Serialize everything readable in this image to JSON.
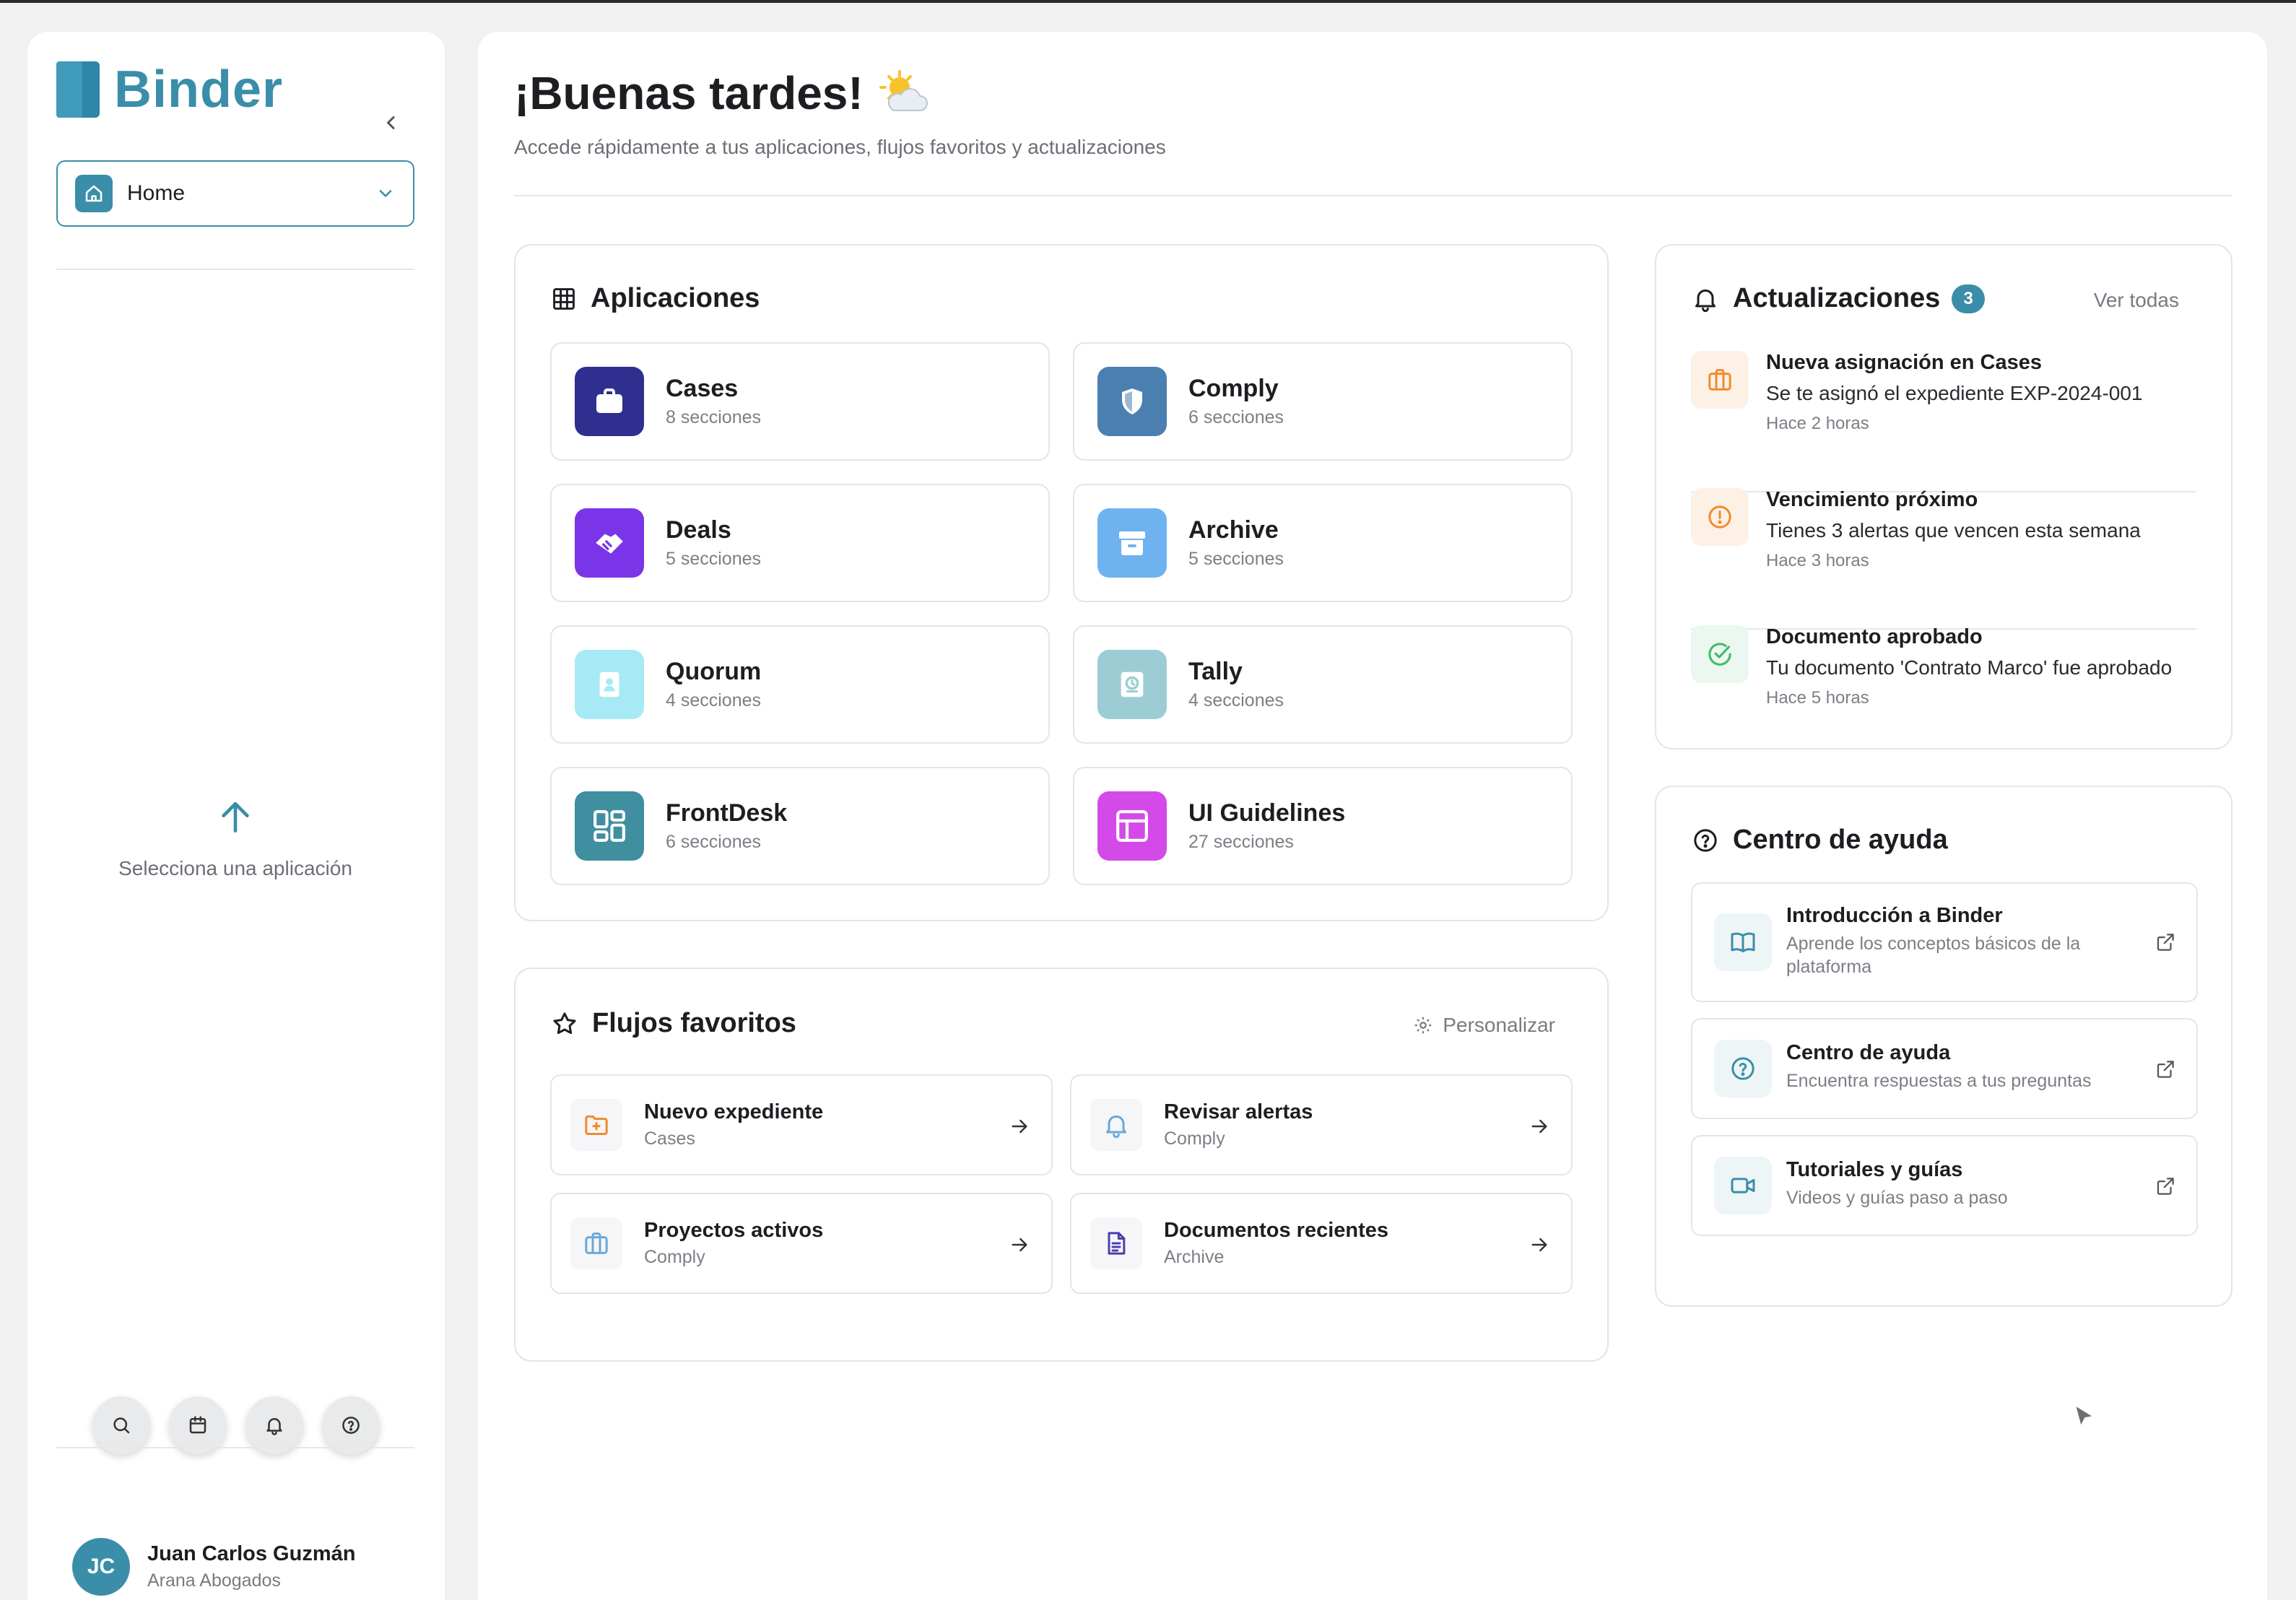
{
  "sidebar": {
    "logo_text": "Binder",
    "home_select": {
      "label": "Home"
    },
    "empty_state": "Selecciona una aplicación",
    "tools": [
      "search-icon",
      "calendar-icon",
      "bell-icon",
      "help-circle-icon"
    ],
    "user": {
      "initials": "JC",
      "name": "Juan Carlos Guzmán",
      "org": "Arana Abogados"
    }
  },
  "header": {
    "greeting": "¡Buenas tardes!",
    "subtitle": "Accede rápidamente a tus aplicaciones, flujos favoritos y actualizaciones"
  },
  "apps": {
    "title": "Aplicaciones",
    "items": [
      {
        "name": "Cases",
        "sections": "8 secciones",
        "color": "#2e2f8f",
        "icon": "briefcase-icon"
      },
      {
        "name": "Comply",
        "sections": "6 secciones",
        "color": "#4a7fb0",
        "icon": "shield-icon"
      },
      {
        "name": "Deals",
        "sections": "5 secciones",
        "color": "#7a35e8",
        "icon": "handshake-icon"
      },
      {
        "name": "Archive",
        "sections": "5 secciones",
        "color": "#6fb2f0",
        "icon": "archive-box-icon"
      },
      {
        "name": "Quorum",
        "sections": "4 secciones",
        "color": "#a7e9f5",
        "icon": "contact-book-icon"
      },
      {
        "name": "Tally",
        "sections": "4 secciones",
        "color": "#9ccdd5",
        "icon": "clock-ledger-icon"
      },
      {
        "name": "FrontDesk",
        "sections": "6 secciones",
        "color": "#3f8fa0",
        "icon": "grid-dashboard-icon"
      },
      {
        "name": "UI Guidelines",
        "sections": "27 secciones",
        "color": "#d44ae8",
        "icon": "layout-icon"
      }
    ]
  },
  "flows": {
    "title": "Flujos favoritos",
    "customize_label": "Personalizar",
    "items": [
      {
        "name": "Nuevo expediente",
        "app": "Cases",
        "icon": "folder-plus-icon",
        "color": "#f08a2e"
      },
      {
        "name": "Revisar alertas",
        "app": "Comply",
        "icon": "bell-icon",
        "color": "#6aa8d8"
      },
      {
        "name": "Proyectos activos",
        "app": "Comply",
        "icon": "briefcase-icon",
        "color": "#6aa8d8"
      },
      {
        "name": "Documentos recientes",
        "app": "Archive",
        "icon": "document-icon",
        "color": "#4a3fb0"
      }
    ]
  },
  "updates": {
    "title": "Actualizaciones",
    "count": "3",
    "see_all": "Ver todas",
    "items": [
      {
        "title": "Nueva asignación en Cases",
        "desc": "Se te asignó el expediente EXP-2024-001",
        "time": "Hace 2 horas",
        "icon": "briefcase-icon",
        "color": "#f08a2e"
      },
      {
        "title": "Vencimiento próximo",
        "desc": "Tienes 3 alertas que vencen esta semana",
        "time": "Hace 3 horas",
        "icon": "alert-circle-icon",
        "color": "#f08a2e"
      },
      {
        "title": "Documento aprobado",
        "desc": "Tu documento 'Contrato Marco' fue aprobado",
        "time": "Hace 5 horas",
        "icon": "check-circle-icon",
        "color": "#3dbb6a"
      }
    ]
  },
  "help": {
    "title": "Centro de ayuda",
    "items": [
      {
        "name": "Introducción a Binder",
        "desc": "Aprende los conceptos básicos de la plataforma",
        "icon": "book-open-icon"
      },
      {
        "name": "Centro de ayuda",
        "desc": "Encuentra respuestas a tus preguntas",
        "icon": "help-circle-icon"
      },
      {
        "name": "Tutoriales y guías",
        "desc": "Videos y guías paso a paso",
        "icon": "video-icon"
      }
    ]
  }
}
